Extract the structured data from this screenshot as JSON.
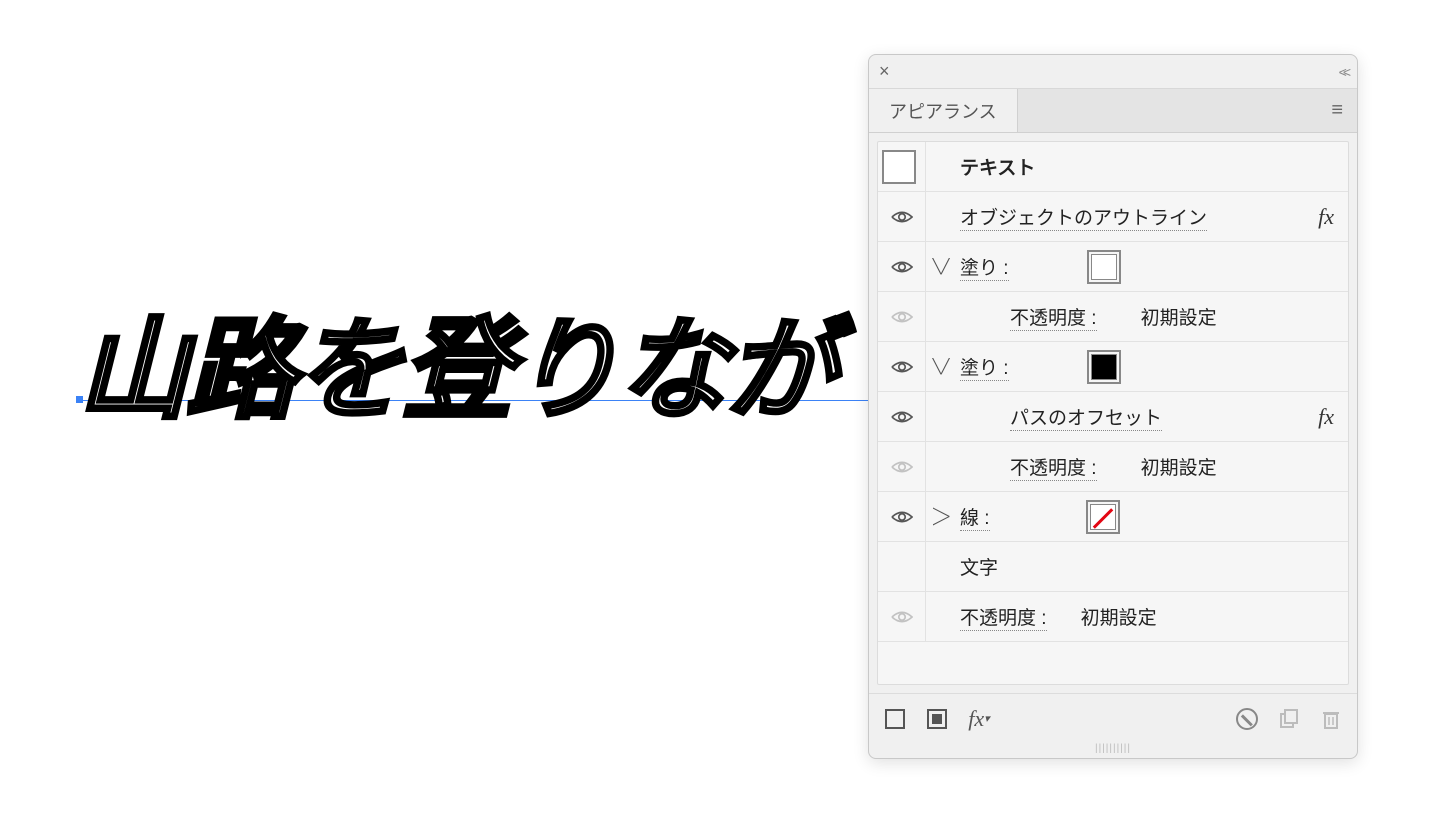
{
  "canvas": {
    "text": "山路を登りなが"
  },
  "panel": {
    "tab_label": "アピアランス",
    "rows": {
      "text_header": "テキスト",
      "outline_effect": "オブジェクトのアウトライン",
      "fill1_label": "塗り :",
      "opacity_label": "不透明度 :",
      "opacity_value": "初期設定",
      "fill2_label": "塗り :",
      "offset_path": "パスのオフセット",
      "stroke_label": "線 :",
      "char_label": "文字"
    },
    "footer": {
      "fx_label": "fx"
    }
  }
}
